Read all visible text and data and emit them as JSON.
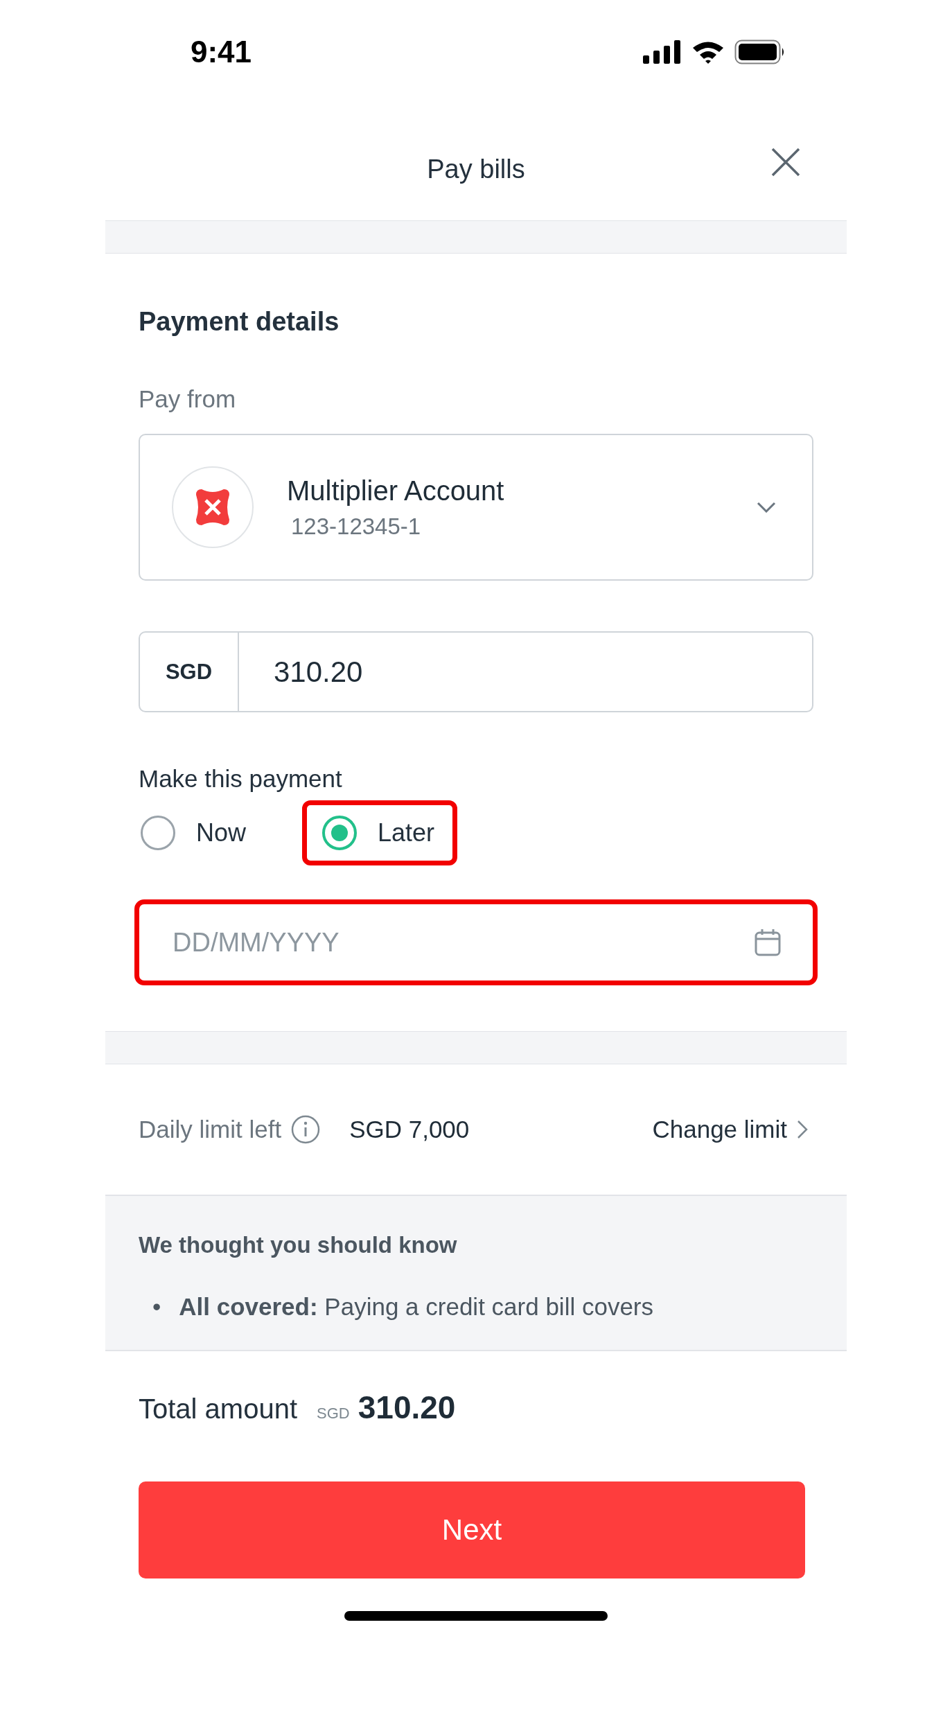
{
  "status_bar": {
    "time": "9:41"
  },
  "header": {
    "title": "Pay bills"
  },
  "payment_details": {
    "heading": "Payment details",
    "pay_from_label": "Pay from",
    "account": {
      "name": "Multiplier Account",
      "number": "123-12345-1"
    },
    "amount": {
      "currency": "SGD",
      "value": "310.20"
    },
    "schedule_label": "Make this payment",
    "options": [
      {
        "label": "Now",
        "selected": false,
        "highlighted": false
      },
      {
        "label": "Later",
        "selected": true,
        "highlighted": true
      }
    ],
    "date_field": {
      "placeholder": "DD/MM/YYYY",
      "highlighted": true
    }
  },
  "limit": {
    "label": "Daily limit left",
    "value": "SGD 7,000",
    "link": "Change limit"
  },
  "notice": {
    "heading": "We thought you should know",
    "items": [
      {
        "bullet": "•",
        "text": "**All covered:** Paying a credit card bill covers"
      }
    ]
  },
  "footer": {
    "total_label": "Total amount",
    "currency": "SGD",
    "total": "310.20",
    "button": "Next"
  }
}
